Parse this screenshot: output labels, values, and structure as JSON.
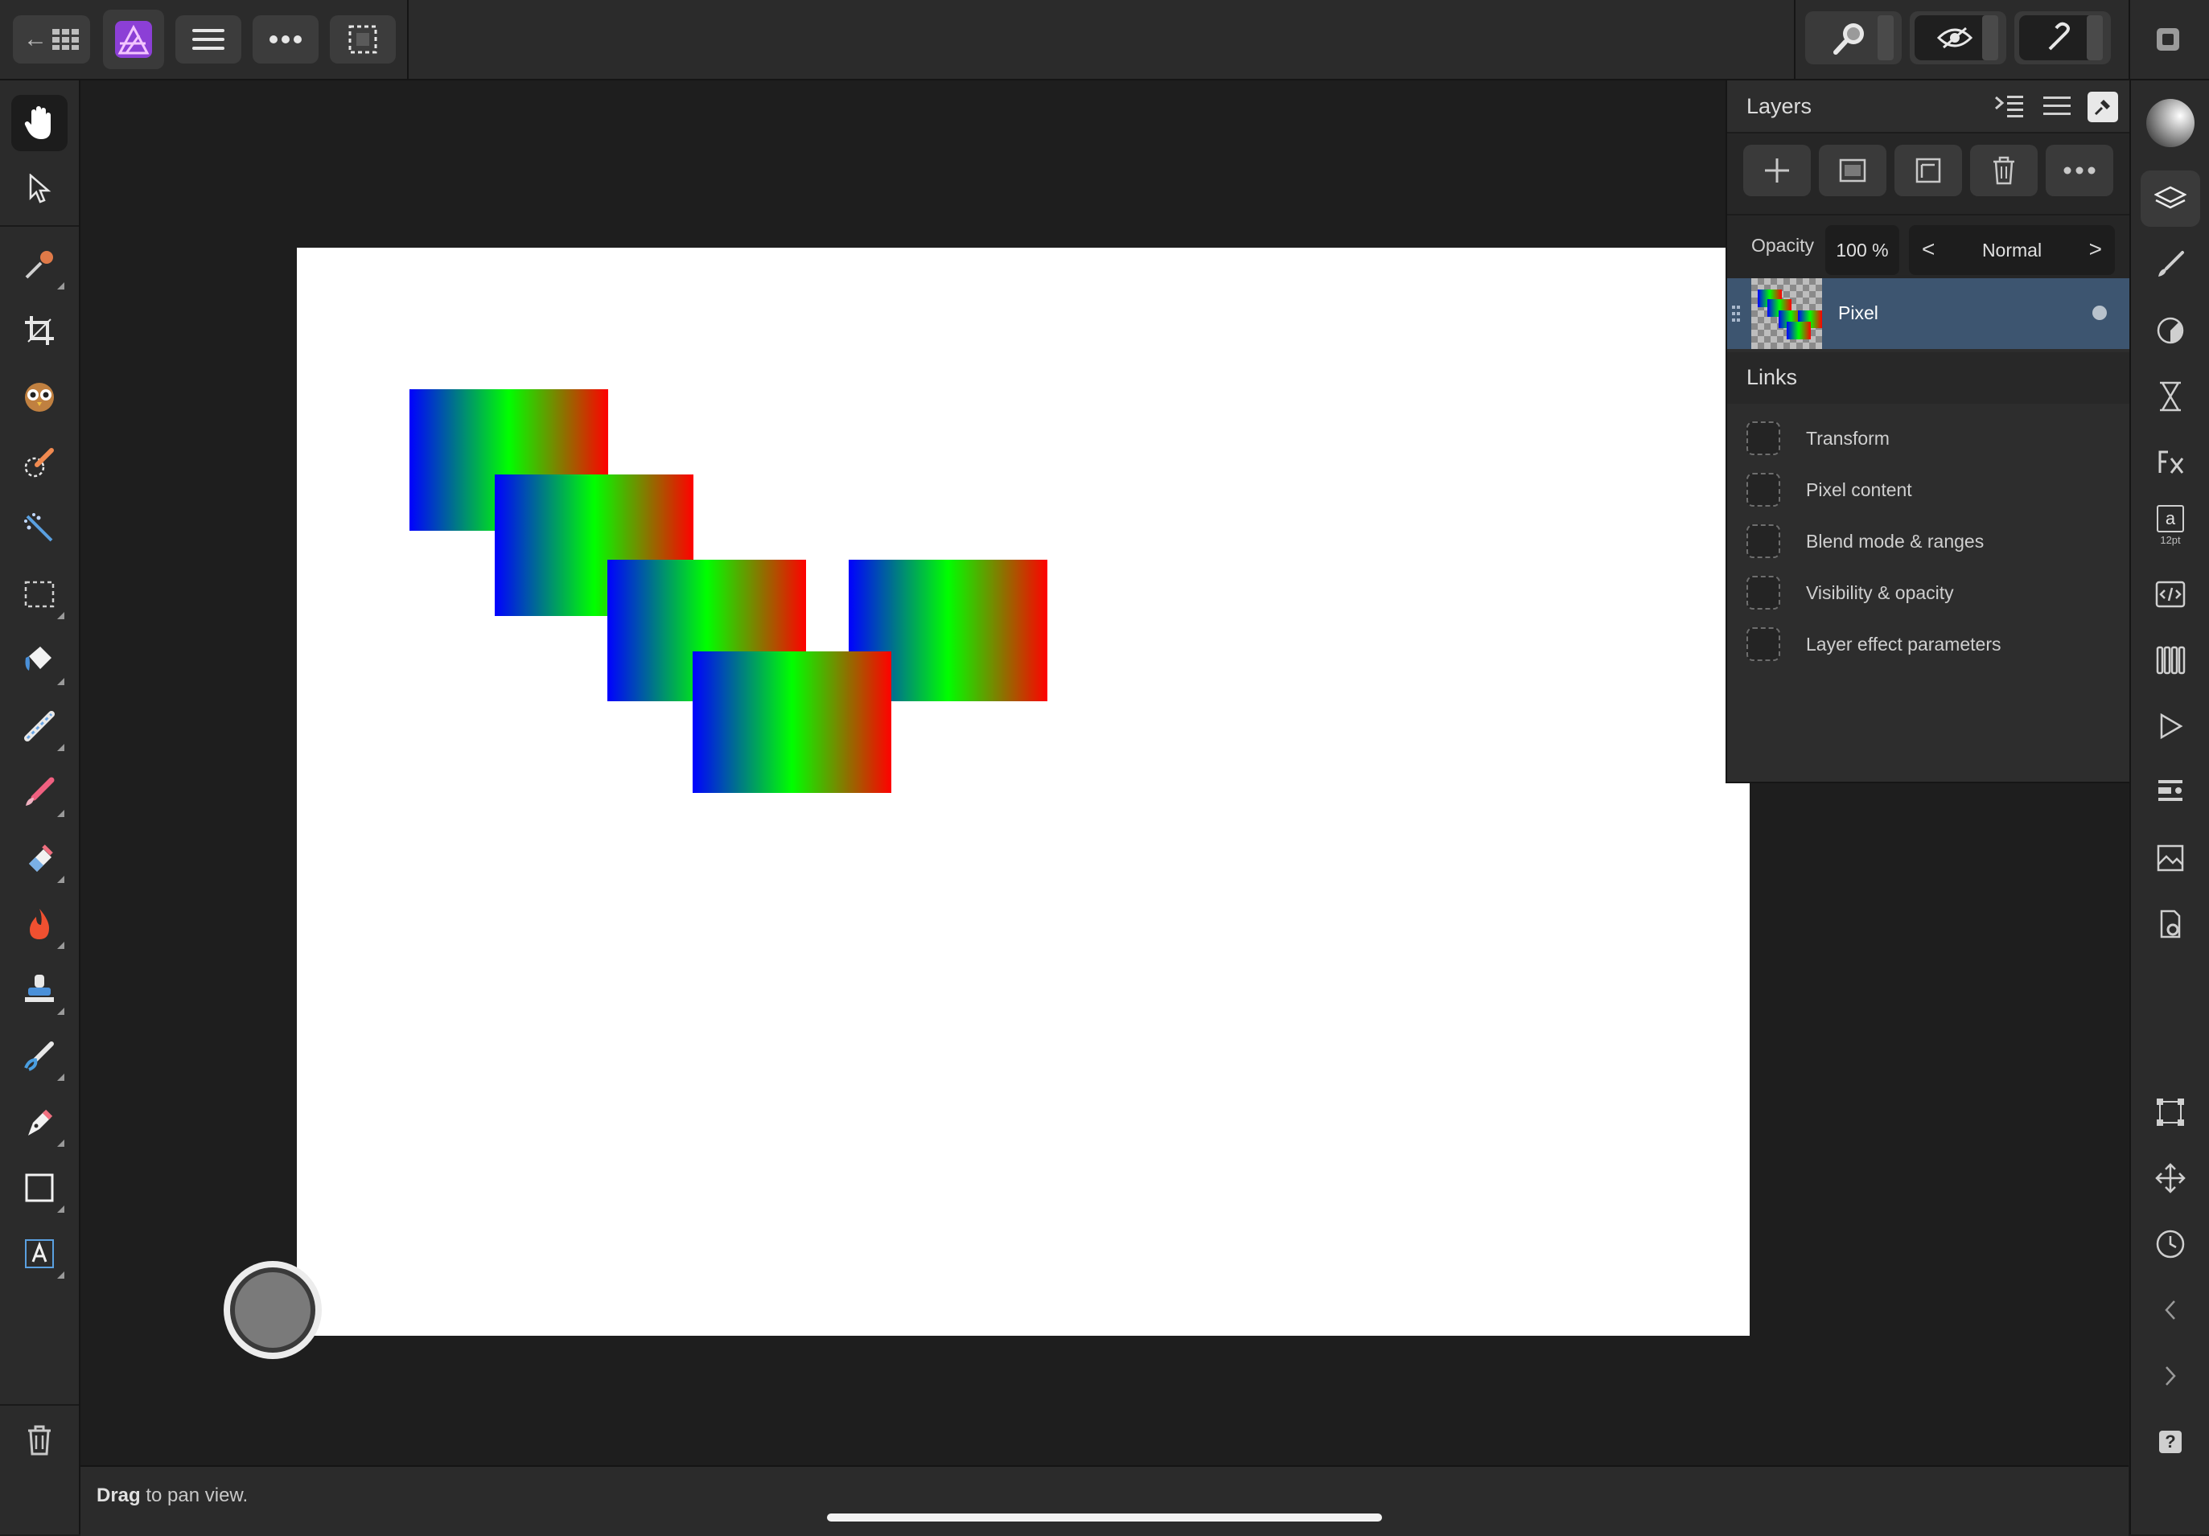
{
  "topbar": {
    "back_label": "←",
    "app_icon": "affinity-photo-icon",
    "menu_icon": "hamburger-icon",
    "more_icon": "more-dots-icon",
    "selection_icon": "marquee-icon",
    "right_groups": [
      "zoom-icon",
      "view-mode-icon",
      "snapping-icon"
    ],
    "persona_icon": "persona-icon"
  },
  "tools": [
    {
      "name": "hand-tool",
      "icon": "hand-icon"
    },
    {
      "name": "move-tool",
      "icon": "arrow-pointer-icon"
    },
    {
      "name": "color-picker-tool",
      "icon": "eyedropper-icon"
    },
    {
      "name": "crop-tool",
      "icon": "crop-icon"
    },
    {
      "name": "red-eye-tool",
      "icon": "owl-icon"
    },
    {
      "name": "selection-brush-tool",
      "icon": "selection-brush-icon"
    },
    {
      "name": "magic-wand-tool",
      "icon": "magic-wand-icon"
    },
    {
      "name": "marquee-tool",
      "icon": "rect-marquee-icon"
    },
    {
      "name": "flood-fill-tool",
      "icon": "paint-bucket-icon"
    },
    {
      "name": "gradient-tool",
      "icon": "gradient-icon"
    },
    {
      "name": "paint-brush-tool",
      "icon": "brush-icon"
    },
    {
      "name": "erase-brush-tool",
      "icon": "eraser-icon"
    },
    {
      "name": "burn-tool",
      "icon": "flame-icon"
    },
    {
      "name": "clone-tool",
      "icon": "stamp-icon"
    },
    {
      "name": "smudge-tool",
      "icon": "smudge-icon"
    },
    {
      "name": "pen-tool",
      "icon": "pen-icon"
    },
    {
      "name": "shape-tool",
      "icon": "rectangle-icon"
    },
    {
      "name": "text-tool",
      "icon": "text-frame-icon"
    }
  ],
  "status": {
    "bold": "Drag",
    "rest": " to pan view."
  },
  "layers_panel": {
    "title": "Layers",
    "opacity_label": "Opacity",
    "opacity_value": "100 %",
    "blend_mode": "Normal",
    "blend_prev": "<",
    "blend_next": ">",
    "layer_name": "Pixel",
    "links_title": "Links",
    "links": [
      "Transform",
      "Pixel content",
      "Blend mode & ranges",
      "Visibility & opacity",
      "Layer effect parameters"
    ]
  },
  "studio_text": {
    "text_panel_letter": "a",
    "text_panel_size": "12pt",
    "help_label": "?"
  },
  "colors": {
    "selection": "#3d5570",
    "gradient_start": "#0000ff",
    "gradient_mid": "#00ff00",
    "gradient_end": "#ff0000"
  }
}
